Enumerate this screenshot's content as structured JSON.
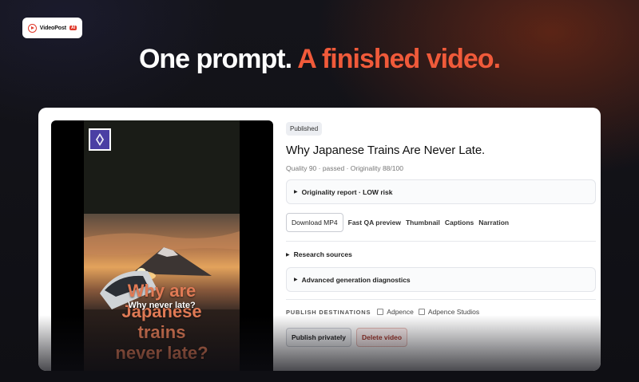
{
  "brand": {
    "name": "VideoPost",
    "tag": "AI"
  },
  "hero": {
    "headline_part1": "One prompt.",
    "headline_part2": "A finished video."
  },
  "player": {
    "caption_big": [
      "Why are",
      "Japanese",
      "trains",
      "never late?"
    ],
    "caption_small": "Why never late?",
    "channel_icon": "channel-avatar-icon"
  },
  "details": {
    "status": "Published",
    "title": "Why Japanese Trains Are Never Late.",
    "meta": "Quality 90 · passed · Originality 88/100",
    "originality_report": "Originality report · LOW risk",
    "download_label": "Download MP4",
    "links": [
      "Fast QA preview",
      "Thumbnail",
      "Captions",
      "Narration"
    ],
    "research_sources": "Research sources",
    "diagnostics": "Advanced generation diagnostics",
    "publish_label": "PUBLISH DESTINATIONS",
    "destinations": [
      "Adpence",
      "Adpence Studios"
    ],
    "publish_button": "Publish privately",
    "delete_button": "Delete video"
  },
  "colors": {
    "accent": "#f05a3a",
    "danger": "#a3352b",
    "caption": "#e07a55"
  }
}
